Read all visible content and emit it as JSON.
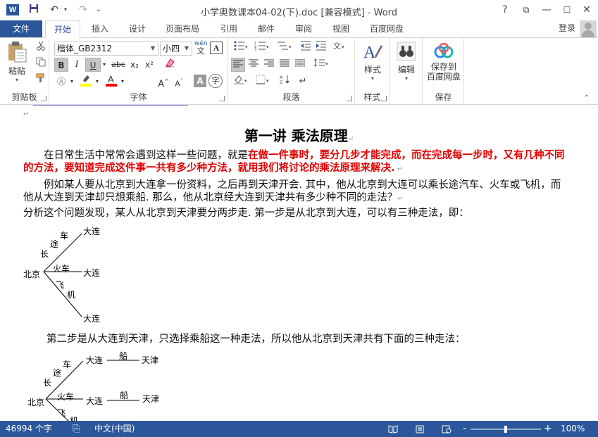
{
  "window": {
    "title": "小学奥数课本04-02(下).doc [兼容模式] - Word",
    "app_icon": "W",
    "quick_access": {
      "save": "save-icon",
      "undo": "↶",
      "redo": "↷",
      "customize": "⌄"
    },
    "controls": {
      "help": "?",
      "restore_ribbon": "⧉",
      "minimize": "—",
      "maximize": "☐",
      "close": "✕"
    }
  },
  "tabs": {
    "file": "文件",
    "items": [
      "开始",
      "插入",
      "设计",
      "页面布局",
      "引用",
      "邮件",
      "审阅",
      "视图",
      "百度网盘"
    ],
    "active_index": 0,
    "login": "登录"
  },
  "ribbon": {
    "clipboard": {
      "label": "剪贴板",
      "paste": "粘贴"
    },
    "font": {
      "label": "字体",
      "font_name": "楷体_GB2312",
      "font_size": "小四",
      "wen_label": "wén",
      "wen_char": "文",
      "A_label": "A",
      "bold": "B",
      "italic": "I",
      "underline": "U",
      "strike": "abc",
      "sub": "x₂",
      "sup": "x²",
      "grow": "A⁺",
      "shrink": "A⁻",
      "case": "Aa",
      "clear": "A",
      "highlight_color": "#ffff00",
      "font_color": "#ff0000",
      "shade": "A",
      "enclose": "字"
    },
    "paragraph": {
      "label": "段落"
    },
    "styles": {
      "label": "样式",
      "button": "样式"
    },
    "editing": {
      "label": "",
      "button": "编辑"
    },
    "save": {
      "label": "保存",
      "button_line1": "保存到",
      "button_line2": "百度网盘"
    }
  },
  "document": {
    "title": "第一讲  乘法原理",
    "para1_normal": "在日常生活中常常会遇到这样一些问题，就是",
    "para1_red": "在做一件事时，要分几步才能完成，而在完成每一步时，又有几种不同的方法，要知道完成这件事一共有多少种方法，就用我们将讨论的乘法原理来解决.",
    "para2": "例如某人要从北京到大连拿一份资料，之后再到天津开会. 其中，他从北京到大连可以乘长途汽车、火车或飞机，而他从大连到天津却只想乘船. 那么，他从北京经大连到天津共有多少种不同的走法？",
    "para3": "分析这个问题发现，某人从北京到天津要分两步走. 第一步是从北京到大连，可以有三种走法，即：",
    "para4": "第二步是从大连到天津，只选择乘船这一种走法，所以他从北京到天津共有下面的三种走法：",
    "diagram1": {
      "origin": "北京",
      "dest": "大连",
      "routes": [
        {
          "chars": [
            "长",
            "途",
            "车"
          ]
        },
        {
          "chars": [
            "火车"
          ]
        },
        {
          "chars": [
            "飞",
            "机"
          ]
        }
      ]
    },
    "diagram2": {
      "origin": "北京",
      "mid": "大连",
      "dest": "天津",
      "ship": "船",
      "routes": [
        {
          "chars": [
            "长",
            "途",
            "车"
          ]
        },
        {
          "chars": [
            "火车"
          ]
        },
        {
          "chars": [
            "飞",
            "机"
          ]
        }
      ]
    }
  },
  "statusbar": {
    "word_count": "46994 个字",
    "language": "中文(中国)",
    "zoom": "100%",
    "zoom_fraction": 0.5,
    "minus": "-",
    "plus": "+"
  }
}
